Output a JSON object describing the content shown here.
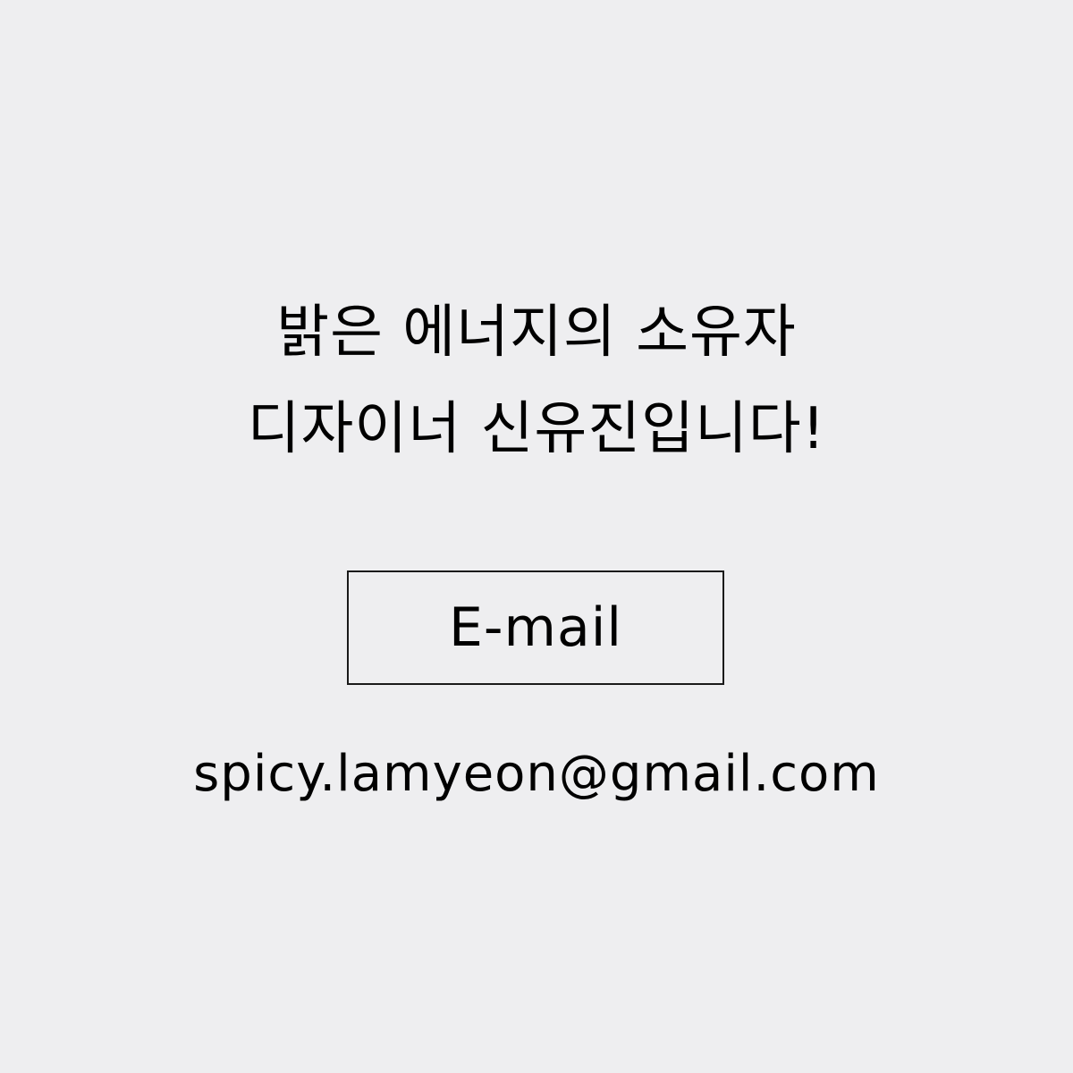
{
  "headline": {
    "line1": "밝은 에너지의 소유자",
    "line2": "디자이너 신유진입니다!"
  },
  "contact": {
    "button_label": "E-mail",
    "email": "spicy.lamyeon@gmail.com"
  },
  "colors": {
    "background": "#eeeef0",
    "text": "#000000",
    "border": "#1a1a1a"
  }
}
